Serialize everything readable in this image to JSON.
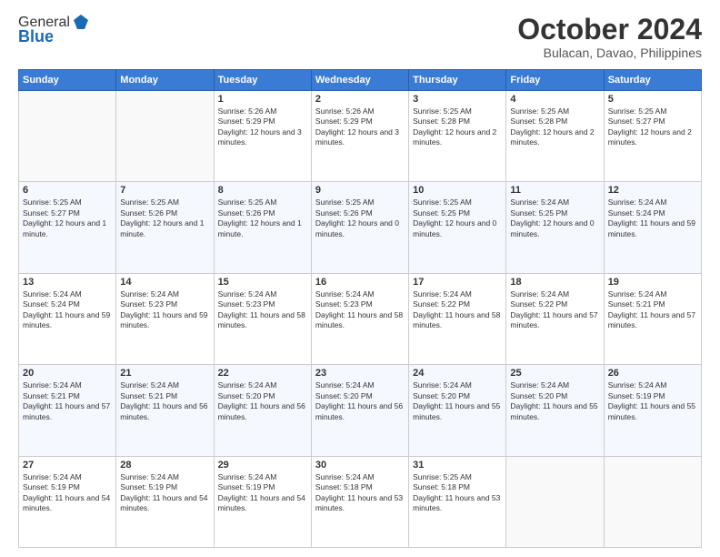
{
  "header": {
    "logo_general": "General",
    "logo_blue": "Blue",
    "month_title": "October 2024",
    "location": "Bulacan, Davao, Philippines"
  },
  "days_of_week": [
    "Sunday",
    "Monday",
    "Tuesday",
    "Wednesday",
    "Thursday",
    "Friday",
    "Saturday"
  ],
  "weeks": [
    [
      {
        "day": "",
        "content": ""
      },
      {
        "day": "",
        "content": ""
      },
      {
        "day": "1",
        "content": "Sunrise: 5:26 AM\nSunset: 5:29 PM\nDaylight: 12 hours and 3 minutes."
      },
      {
        "day": "2",
        "content": "Sunrise: 5:26 AM\nSunset: 5:29 PM\nDaylight: 12 hours and 3 minutes."
      },
      {
        "day": "3",
        "content": "Sunrise: 5:25 AM\nSunset: 5:28 PM\nDaylight: 12 hours and 2 minutes."
      },
      {
        "day": "4",
        "content": "Sunrise: 5:25 AM\nSunset: 5:28 PM\nDaylight: 12 hours and 2 minutes."
      },
      {
        "day": "5",
        "content": "Sunrise: 5:25 AM\nSunset: 5:27 PM\nDaylight: 12 hours and 2 minutes."
      }
    ],
    [
      {
        "day": "6",
        "content": "Sunrise: 5:25 AM\nSunset: 5:27 PM\nDaylight: 12 hours and 1 minute."
      },
      {
        "day": "7",
        "content": "Sunrise: 5:25 AM\nSunset: 5:26 PM\nDaylight: 12 hours and 1 minute."
      },
      {
        "day": "8",
        "content": "Sunrise: 5:25 AM\nSunset: 5:26 PM\nDaylight: 12 hours and 1 minute."
      },
      {
        "day": "9",
        "content": "Sunrise: 5:25 AM\nSunset: 5:26 PM\nDaylight: 12 hours and 0 minutes."
      },
      {
        "day": "10",
        "content": "Sunrise: 5:25 AM\nSunset: 5:25 PM\nDaylight: 12 hours and 0 minutes."
      },
      {
        "day": "11",
        "content": "Sunrise: 5:24 AM\nSunset: 5:25 PM\nDaylight: 12 hours and 0 minutes."
      },
      {
        "day": "12",
        "content": "Sunrise: 5:24 AM\nSunset: 5:24 PM\nDaylight: 11 hours and 59 minutes."
      }
    ],
    [
      {
        "day": "13",
        "content": "Sunrise: 5:24 AM\nSunset: 5:24 PM\nDaylight: 11 hours and 59 minutes."
      },
      {
        "day": "14",
        "content": "Sunrise: 5:24 AM\nSunset: 5:23 PM\nDaylight: 11 hours and 59 minutes."
      },
      {
        "day": "15",
        "content": "Sunrise: 5:24 AM\nSunset: 5:23 PM\nDaylight: 11 hours and 58 minutes."
      },
      {
        "day": "16",
        "content": "Sunrise: 5:24 AM\nSunset: 5:23 PM\nDaylight: 11 hours and 58 minutes."
      },
      {
        "day": "17",
        "content": "Sunrise: 5:24 AM\nSunset: 5:22 PM\nDaylight: 11 hours and 58 minutes."
      },
      {
        "day": "18",
        "content": "Sunrise: 5:24 AM\nSunset: 5:22 PM\nDaylight: 11 hours and 57 minutes."
      },
      {
        "day": "19",
        "content": "Sunrise: 5:24 AM\nSunset: 5:21 PM\nDaylight: 11 hours and 57 minutes."
      }
    ],
    [
      {
        "day": "20",
        "content": "Sunrise: 5:24 AM\nSunset: 5:21 PM\nDaylight: 11 hours and 57 minutes."
      },
      {
        "day": "21",
        "content": "Sunrise: 5:24 AM\nSunset: 5:21 PM\nDaylight: 11 hours and 56 minutes."
      },
      {
        "day": "22",
        "content": "Sunrise: 5:24 AM\nSunset: 5:20 PM\nDaylight: 11 hours and 56 minutes."
      },
      {
        "day": "23",
        "content": "Sunrise: 5:24 AM\nSunset: 5:20 PM\nDaylight: 11 hours and 56 minutes."
      },
      {
        "day": "24",
        "content": "Sunrise: 5:24 AM\nSunset: 5:20 PM\nDaylight: 11 hours and 55 minutes."
      },
      {
        "day": "25",
        "content": "Sunrise: 5:24 AM\nSunset: 5:20 PM\nDaylight: 11 hours and 55 minutes."
      },
      {
        "day": "26",
        "content": "Sunrise: 5:24 AM\nSunset: 5:19 PM\nDaylight: 11 hours and 55 minutes."
      }
    ],
    [
      {
        "day": "27",
        "content": "Sunrise: 5:24 AM\nSunset: 5:19 PM\nDaylight: 11 hours and 54 minutes."
      },
      {
        "day": "28",
        "content": "Sunrise: 5:24 AM\nSunset: 5:19 PM\nDaylight: 11 hours and 54 minutes."
      },
      {
        "day": "29",
        "content": "Sunrise: 5:24 AM\nSunset: 5:19 PM\nDaylight: 11 hours and 54 minutes."
      },
      {
        "day": "30",
        "content": "Sunrise: 5:24 AM\nSunset: 5:18 PM\nDaylight: 11 hours and 53 minutes."
      },
      {
        "day": "31",
        "content": "Sunrise: 5:25 AM\nSunset: 5:18 PM\nDaylight: 11 hours and 53 minutes."
      },
      {
        "day": "",
        "content": ""
      },
      {
        "day": "",
        "content": ""
      }
    ]
  ]
}
